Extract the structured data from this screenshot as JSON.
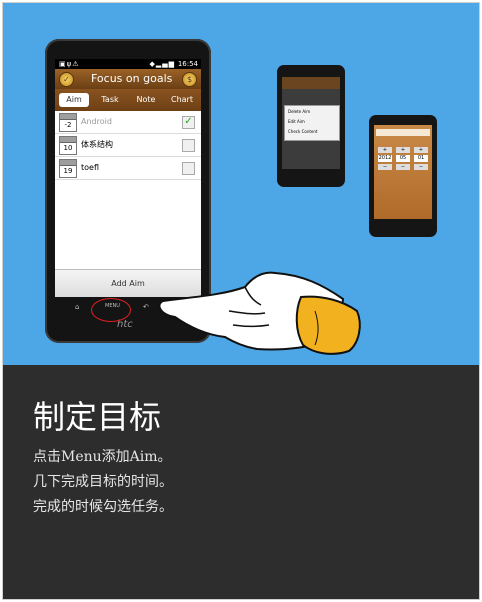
{
  "colors": {
    "sky": "#4da7e6",
    "panel": "#2d2d2d",
    "titlebar_brown": "#7a4a18",
    "check_green": "#2aa02a",
    "menu_circle_red": "#e02020"
  },
  "phone": {
    "status_time": "16:54",
    "app_title": "Focus on goals",
    "tabs": [
      "Aim",
      "Task",
      "Note",
      "Chart"
    ],
    "active_tab": "Aim",
    "rows": [
      {
        "day": "-2",
        "label": "Android",
        "checked": true
      },
      {
        "day": "10",
        "label": "体系结构",
        "checked": false
      },
      {
        "day": "19",
        "label": "toefl",
        "checked": false
      }
    ],
    "add_button": "Add Aim",
    "menu_key": "MENU",
    "brand": "htc"
  },
  "context_menu": {
    "items": [
      "Delete Aim",
      "Edit Aim",
      "Check Content"
    ]
  },
  "date_picker": {
    "values": [
      "2012",
      "05",
      "01"
    ]
  },
  "caption": {
    "title": "制定目标",
    "lines": [
      "点击Menu添加Aim。",
      "几下完成目标的时间。",
      "完成的时候勾选任务。"
    ]
  }
}
